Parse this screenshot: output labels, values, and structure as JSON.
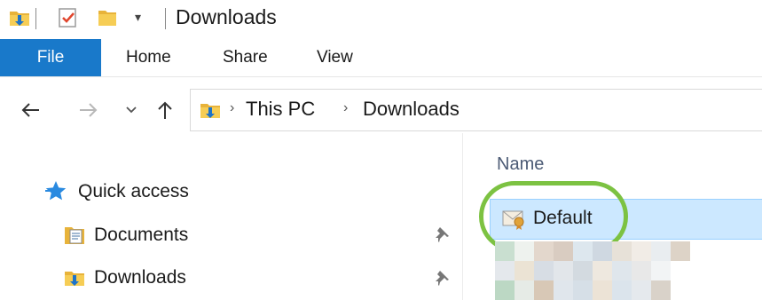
{
  "window": {
    "title": "Downloads"
  },
  "quick_access_toolbar": {
    "icons": [
      "folder-download-icon",
      "properties-checkmark-icon",
      "new-folder-icon",
      "customize-dropdown-icon"
    ]
  },
  "ribbon": {
    "tabs": [
      {
        "label": "File",
        "active": true
      },
      {
        "label": "Home"
      },
      {
        "label": "Share"
      },
      {
        "label": "View"
      }
    ]
  },
  "navigation": {
    "back": "←",
    "forward": "→",
    "recent": "⌄",
    "up": "↑"
  },
  "address_bar": {
    "breadcrumb": [
      "This PC",
      "Downloads"
    ],
    "separator": "›"
  },
  "nav_pane": {
    "items": [
      {
        "label": "Quick access",
        "icon": "star-icon"
      },
      {
        "label": "Documents",
        "icon": "documents-folder-icon",
        "pinned": true
      },
      {
        "label": "Downloads",
        "icon": "downloads-folder-icon",
        "pinned": true
      }
    ]
  },
  "file_list": {
    "column_header": "Name",
    "rows": [
      {
        "label": "Default",
        "selected": true,
        "icon": "certificate-file-icon"
      }
    ]
  },
  "colors": {
    "file_tab": "#1979ca",
    "selection": "#cce8ff",
    "annotation_ring": "#7cc242"
  }
}
